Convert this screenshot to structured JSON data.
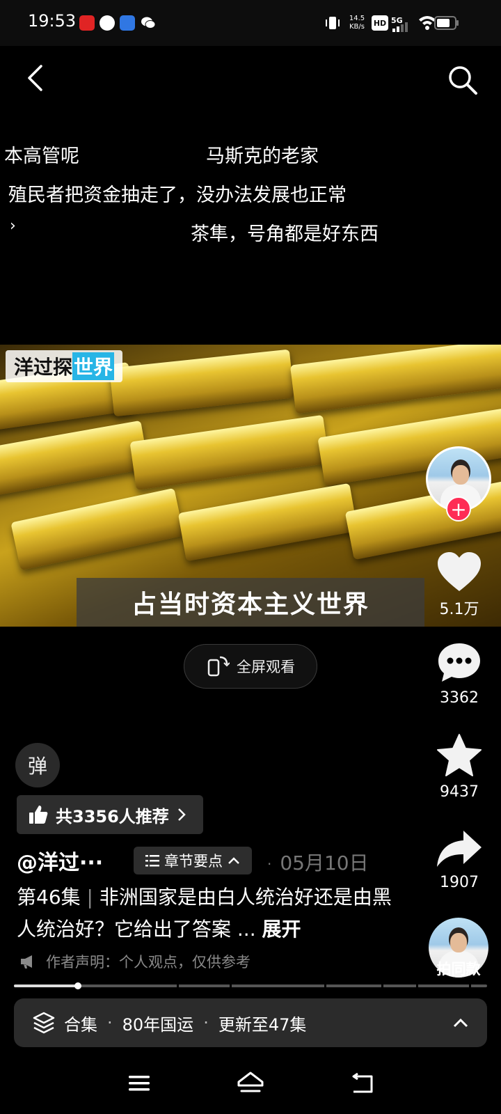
{
  "status_bar": {
    "time": "19:53",
    "net_speed_value": "14.5",
    "net_speed_unit": "KB/s",
    "hd_label": "HD",
    "signal_label": "5G",
    "icons": [
      "news-app-icon",
      "app-icon",
      "baidu-icon",
      "wechat-icon",
      "vibrate-icon",
      "wifi-icon",
      "battery-icon"
    ]
  },
  "topnav": {
    "icons": [
      "back-icon",
      "search-icon"
    ]
  },
  "danmaku": [
    "本高管呢",
    "马斯克的老家",
    "殖民者把资金抽走了，没办法发展也正常",
    "›",
    "茶隼，号角都是好东西"
  ],
  "video": {
    "watermark_prefix": "洋过探",
    "watermark_highlight": "世界",
    "subtitle": "占当时资本主义世界"
  },
  "fullscreen_label": "全屏观看",
  "actions": {
    "likes": "5.1万",
    "comments": "3362",
    "favorites": "9437",
    "shares": "1907",
    "follow_symbol": "+",
    "same_style_label": "拍同款"
  },
  "danmaku_toggle_label": "弹",
  "recommend_label": "共3356人推荐",
  "author": "@洋过···",
  "chapter_label": "章节要点",
  "date_dot": "·",
  "date": "05月10日",
  "description": {
    "episode": "第46集",
    "separator": "|",
    "text": "非洲国家是由白人统治好还是由黑人统治好？它给出了答案 ...",
    "expand": "展开"
  },
  "statement": "作者声明：个人观点，仅供参考",
  "progress": {
    "played_fraction": 0.135
  },
  "collection": {
    "label": "合集",
    "sep": "·",
    "name": "80年国运",
    "update": "更新至47集"
  },
  "colors": {
    "accent_red": "#fe2c55",
    "watermark_blue": "#27b5e6",
    "background": "#000000"
  }
}
